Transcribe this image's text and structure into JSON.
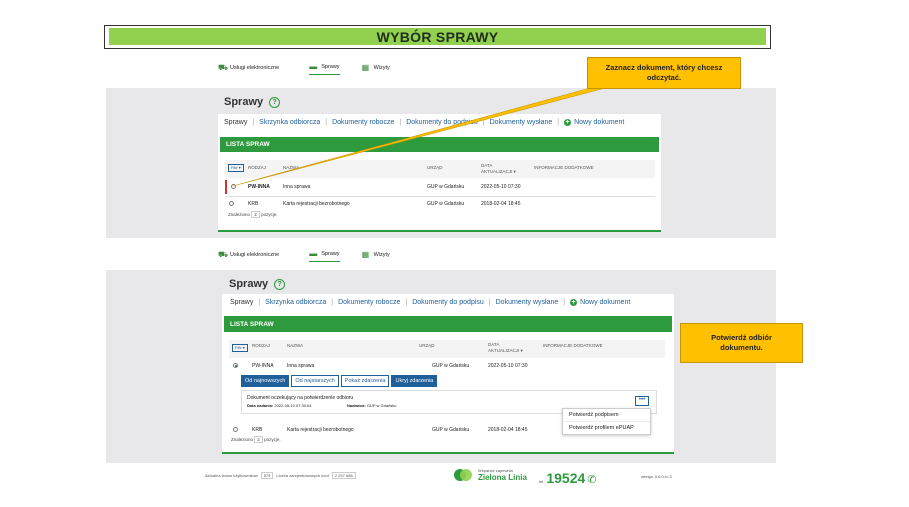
{
  "title": "WYBÓR SPRAWY",
  "tabs": [
    {
      "label": "Usługi elektroniczne",
      "icon": "cart-icon"
    },
    {
      "label": "Sprawy",
      "icon": "folder-icon"
    },
    {
      "label": "Wizyty",
      "icon": "calendar-icon"
    }
  ],
  "page_title": "Sprawy",
  "help_glyph": "?",
  "nav": {
    "items": [
      "Sprawy",
      "Skrzynka odbiorcza",
      "Dokumenty robocze",
      "Dokumenty do podpisu",
      "Dokumenty wysłane"
    ],
    "new_doc": "Nowy dokument"
  },
  "list_title": "LISTA SPRAW",
  "filter_label": "Filtr ▾",
  "columns": {
    "rodzaj": "RODZAJ",
    "nazwa": "NAZWA",
    "urzad": "URZĄD",
    "data": "DATA",
    "data2": "AKTUALIZACJI ▾",
    "info": "INFORMACJE DODATKOWE"
  },
  "rows": [
    {
      "rodzaj": "PW-INNA",
      "nazwa": "Inna sprawa",
      "urzad": "GUP w Gdańsku",
      "data": "2022-05-10 07:30"
    },
    {
      "rodzaj": "KRB",
      "nazwa": "Karta rejestracji bezrobotnego",
      "urzad": "GUP w Gdańsku",
      "data": "2018-02-04 18:45"
    }
  ],
  "found": {
    "prefix": "Znaleziono",
    "count": "2",
    "suffix": "pozycje."
  },
  "callout1": "Zaznacz dokument, który chcesz odczytać.",
  "callout2": "Potwierdź odbiór dokumentu.",
  "segments": [
    "Od najnowszych",
    "Od najstarszych",
    "Pokaż zdarzenia",
    "Ukryj zdarzenia"
  ],
  "event": {
    "text": "Dokument oczekujący na potwierdzenie odbioru",
    "date_label": "Data nadania:",
    "date_value": "2022-05-10 07:30:04",
    "sender_label": "Nadawca:",
    "sender_value": "GUP w Gdańsku"
  },
  "dots": "•••",
  "menu": [
    "Potwierdź podpisem",
    "Potwierdź profilem ePUAP"
  ],
  "footer": {
    "users_label": "Aktualna liczba użytkowników",
    "users_value": "575",
    "reg_label": "Liczba zarejestrowanych kont",
    "reg_value": "2 237 686",
    "support": "Wsparcie zapewnia",
    "green_line": "Zielona Linia",
    "tel_prefix": "tel.",
    "phone": "19524",
    "version": "wersja: 5.6.0-rc.3"
  },
  "colors": {
    "accent_green": "#2e9a3e",
    "title_green": "#92d050",
    "callout": "#ffc000",
    "link_blue": "#1f5f9a"
  }
}
